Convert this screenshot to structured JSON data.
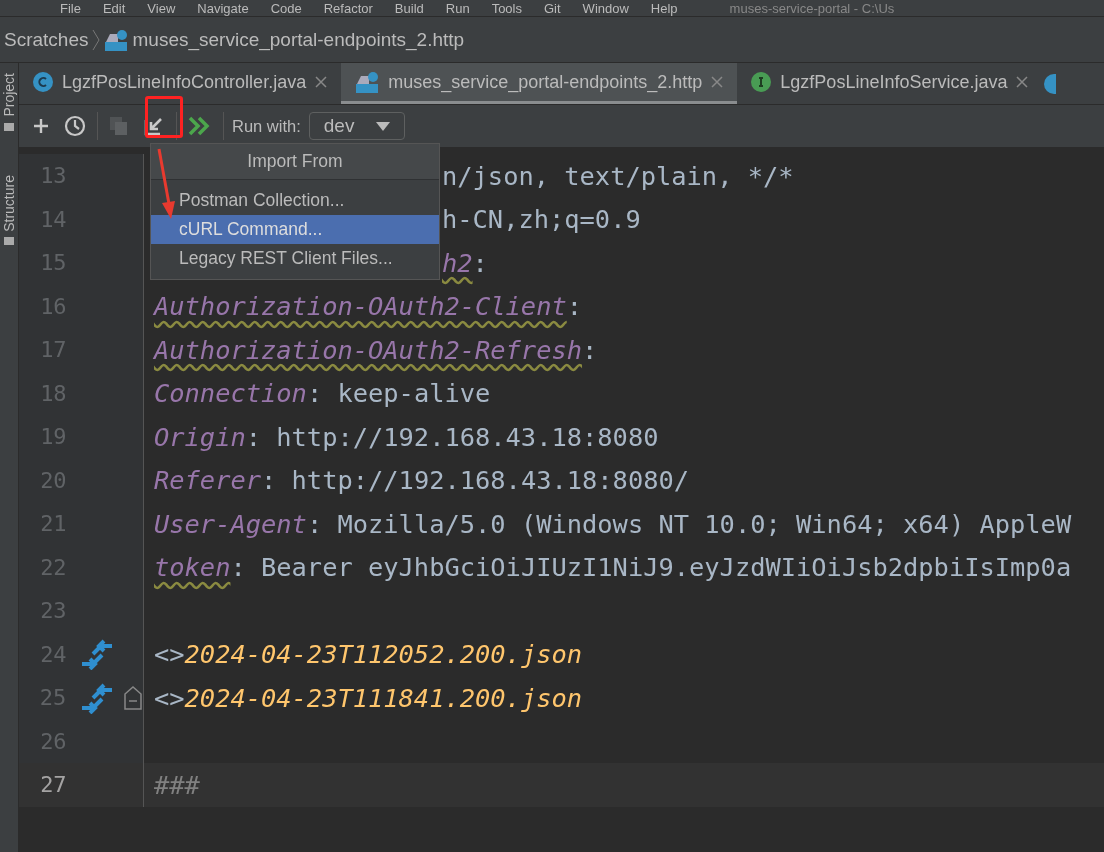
{
  "menu_bar": {
    "items": [
      "File",
      "Edit",
      "View",
      "Navigate",
      "Code",
      "Refactor",
      "Build",
      "Run",
      "Tools",
      "Git",
      "Window",
      "Help"
    ],
    "title": "muses-service-portal - C:\\Us"
  },
  "breadcrumb": {
    "items": [
      "Scratches",
      "muses_service_portal-endpoints_2.http"
    ]
  },
  "side_panels": [
    "Project",
    "Structure"
  ],
  "tabs": [
    {
      "label": "LgzfPosLineInfoController.java",
      "kind": "class",
      "selected": false
    },
    {
      "label": "muses_service_portal-endpoints_2.http",
      "kind": "http",
      "selected": true
    },
    {
      "label": "LgzfPosLineInfoService.java",
      "kind": "interface",
      "selected": false
    }
  ],
  "toolbar": {
    "buttons": [
      {
        "kind": "add",
        "disabled": false
      },
      {
        "kind": "history",
        "disabled": false
      },
      {
        "kind": "copy",
        "disabled": true
      },
      {
        "kind": "import",
        "disabled": false
      },
      {
        "kind": "run-all",
        "disabled": false
      }
    ],
    "run_with_label": "Run with:",
    "environment": "dev"
  },
  "popup": {
    "title": "Import From",
    "items": [
      {
        "label": "Postman Collection...",
        "selected": false
      },
      {
        "label": "cURL Command...",
        "selected": true
      },
      {
        "label": "Legacy REST Client Files...",
        "selected": false
      }
    ]
  },
  "lines": [
    {
      "number": "13",
      "covered": true,
      "current": false,
      "segments": [
        {
          "text": "n/json, text/plain, */*",
          "kind": "plain"
        }
      ]
    },
    {
      "number": "14",
      "covered": true,
      "current": false,
      "segments": [
        {
          "text": "h-CN,zh;q=0.9",
          "kind": "plain"
        }
      ]
    },
    {
      "number": "15",
      "covered": true,
      "current": false,
      "segments": [
        {
          "text": "h2",
          "kind": "key",
          "warn": true
        },
        {
          "text": ":",
          "kind": "plain"
        }
      ]
    },
    {
      "number": "16",
      "current": false,
      "segments": [
        {
          "text": "Authorization-OAuth2-Client",
          "kind": "key",
          "warn": true
        },
        {
          "text": ":",
          "kind": "plain"
        }
      ]
    },
    {
      "number": "17",
      "current": false,
      "segments": [
        {
          "text": "Authorization-OAuth2-Refresh",
          "kind": "key",
          "warn": true
        },
        {
          "text": ":",
          "kind": "plain"
        }
      ]
    },
    {
      "number": "18",
      "current": false,
      "segments": [
        {
          "text": "Connection",
          "kind": "key"
        },
        {
          "text": ": keep-alive",
          "kind": "plain"
        }
      ]
    },
    {
      "number": "19",
      "current": false,
      "segments": [
        {
          "text": "Origin",
          "kind": "key"
        },
        {
          "text": ": http://192.168.43.18:8080",
          "kind": "plain"
        }
      ]
    },
    {
      "number": "20",
      "current": false,
      "segments": [
        {
          "text": "Referer",
          "kind": "key"
        },
        {
          "text": ": http://192.168.43.18:8080/",
          "kind": "plain"
        }
      ]
    },
    {
      "number": "21",
      "current": false,
      "segments": [
        {
          "text": "User-Agent",
          "kind": "key"
        },
        {
          "text": ": Mozilla/5.0 (Windows NT 10.0; Win64; x64) AppleW",
          "kind": "plain"
        }
      ]
    },
    {
      "number": "22",
      "current": false,
      "segments": [
        {
          "text": "token",
          "kind": "key",
          "warn": true
        },
        {
          "text": ": Bearer eyJhbGciOiJIUzI1NiJ9.eyJzdWIiOiJsb2dpbiIsImp0a",
          "kind": "plain"
        }
      ]
    },
    {
      "number": "23",
      "current": false
    },
    {
      "number": "24",
      "current": false,
      "compare": true,
      "segments": [
        {
          "text": "<>",
          "kind": "punct"
        },
        {
          "text": "2024-04-23T112052.200.json",
          "kind": "file"
        }
      ]
    },
    {
      "number": "25",
      "current": false,
      "compare": true,
      "fold": true,
      "segments": [
        {
          "text": "<>",
          "kind": "punct"
        },
        {
          "text": "2024-04-23T111841.200.json",
          "kind": "file"
        }
      ]
    },
    {
      "number": "26",
      "current": false
    },
    {
      "number": "27",
      "current": true,
      "segments": [
        {
          "text": "###",
          "kind": "comment"
        }
      ]
    }
  ]
}
